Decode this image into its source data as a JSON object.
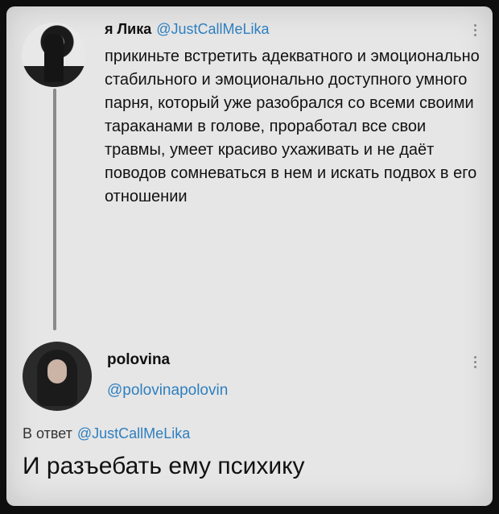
{
  "tweet1": {
    "author_name": "я Лика",
    "author_handle": "@JustCallMeLika",
    "text": "прикиньте встретить адекватного и эмоционально стабильного и эмоционально доступного умного парня, который уже разобрался со всеми своими тараканами в голове, проработал все свои травмы, умеет красиво ухаживать и не даёт поводов сомневаться в нем и искать подвох в его отношении"
  },
  "tweet2": {
    "author_name": "polovina",
    "author_handle": "@polovinapolovin",
    "reply_prefix": "В ответ",
    "reply_handle": "@JustCallMeLika",
    "text": "И разъебать ему психику"
  },
  "icons": {
    "more": "more-vertical-icon"
  },
  "colors": {
    "link": "#2e7fbf",
    "text": "#111111",
    "card_bg": "#e6e6e6"
  }
}
